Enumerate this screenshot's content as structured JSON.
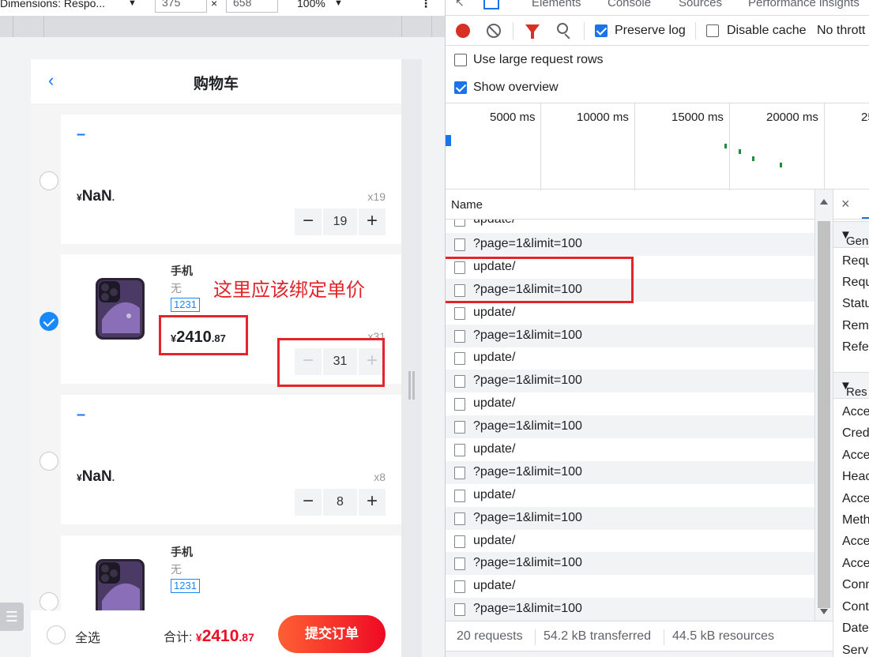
{
  "emulation_bar": {
    "dimensions_label": "Dimensions: Respo...",
    "dropdown_arrow": "▼",
    "width": "375",
    "times": "×",
    "height": "658",
    "zoom": "100%",
    "zoom_arrow": "▼",
    "more": "⋮"
  },
  "cart": {
    "back": "‹",
    "title": "购物车",
    "items": [
      {
        "dash": "–",
        "price_prefix": "¥",
        "price_text": "NaN",
        "price_suffix": ".",
        "qty_label": "x19",
        "qty": "19",
        "minus": "−",
        "plus": "+"
      },
      {
        "name": "手机",
        "desc": "无",
        "tag": "1231",
        "currency": "¥",
        "price_int": "2410",
        "price_dec": ".87",
        "qty_label": "x31",
        "qty": "31",
        "minus": "−",
        "plus": "+",
        "checked": true
      },
      {
        "dash": "–",
        "price_prefix": "¥",
        "price_text": "NaN",
        "price_suffix": ".",
        "qty_label": "x8",
        "qty": "8",
        "minus": "−",
        "plus": "+"
      },
      {
        "name": "手机",
        "desc": "无",
        "tag": "1231"
      }
    ],
    "annotation": "这里应该绑定单价",
    "select_all": "全选",
    "total_label": "合计: ",
    "total_currency": "¥",
    "total_int": "2410",
    "total_dec": ".87",
    "submit": "提交订单",
    "float_icon": "☰"
  },
  "devtools": {
    "tabs": [
      "Elements",
      "Console",
      "Sources",
      "Performance insights"
    ],
    "preserve_log": "Preserve log",
    "disable_cache": "Disable cache",
    "throttle": "No thrott",
    "large_rows": "Use large request rows",
    "show_overview": "Show overview",
    "timeline": [
      "5000 ms",
      "10000 ms",
      "15000 ms",
      "20000 ms",
      "25"
    ],
    "name_header": "Name",
    "requests": [
      "update/",
      "?page=1&limit=100",
      "update/",
      "?page=1&limit=100",
      "update/",
      "?page=1&limit=100",
      "update/",
      "?page=1&limit=100",
      "update/",
      "?page=1&limit=100",
      "update/",
      "?page=1&limit=100",
      "update/",
      "?page=1&limit=100",
      "update/",
      "?page=1&limit=100",
      "update/",
      "?page=1&limit=100"
    ],
    "status": {
      "requests": "20 requests",
      "transferred": "54.2 kB transferred",
      "resources": "44.5 kB resources"
    },
    "side": {
      "close": "×",
      "general": "Gen",
      "general_items": [
        "Requ",
        "Requ",
        "Statu",
        "Remo",
        "Refer"
      ],
      "response": "Res",
      "response_items": [
        "Acces",
        "Crede",
        "Acces",
        "Heac",
        "Acces",
        "Meth",
        "Acces",
        "Acces",
        "Conn",
        "Conte",
        "Date",
        "Servi"
      ]
    }
  },
  "colors": {
    "accent_blue": "#1989fa",
    "annotation_red": "#e3242b",
    "price_red": "#ee0a24",
    "record_red": "#d93025"
  }
}
